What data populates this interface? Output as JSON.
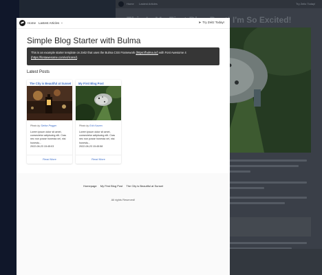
{
  "background_window": {
    "nav": {
      "home_label": "Home",
      "articles_label": "Lastest Articles",
      "cta_label": "Try Zeitz Today!"
    },
    "title": "This Is My First Blog Post! I'm So Excited!"
  },
  "nav": {
    "home_label": "Home",
    "articles_label": "Lastest Articles",
    "chevron": "⌄",
    "cta_icon": "➤",
    "cta_label": "Try Zeitz Today!"
  },
  "page": {
    "title": "Simple Blog Starter with Bulma",
    "notice_intro": "This is an example starter template on Zeitz that uses the Bulma CSS Framework ",
    "notice_link1": "(https://bulma.io/)",
    "notice_mid": " with Font Awesome 4 ",
    "notice_link2": "(https://fontawesome.com/v4/icons/)",
    "notice_end": ".",
    "section_title": "Latest Posts"
  },
  "posts": [
    {
      "title": "The City is Beautiful at Sunset",
      "credit_prefix": "Photo by ",
      "credit_name": "Stefan Pegger",
      "excerpt": "Lorem ipsum dolor sit amet, consectetur adipiscing elit. Cras nec non posse honesta vel, nisi honestu...",
      "date": "2022-08-23 15:45:03",
      "read_more": "Read More"
    },
    {
      "title": "My First Blog Post",
      "credit_prefix": "Photo by ",
      "credit_name": "Erik Karzen",
      "excerpt": "Lorem ipsum dolor sit amet, consectetur adipiscing elit. Cras nec non posse honesta vel, nisi honestu...",
      "date": "2022-08-23 15:45:58",
      "read_more": "Read More"
    }
  ],
  "footer": {
    "links": [
      "Homepage",
      "My First Blog Post",
      "The City is Beautiful at Sunset"
    ],
    "copyright": "All rights Reserved!"
  },
  "colors": {
    "link": "#3e6ec9",
    "notice_bg": "#363636",
    "background": "#1f2733"
  },
  "icons": {
    "logo": "zeitz-logo-icon",
    "cta": "paper-plane-icon",
    "chevron": "chevron-down-icon"
  }
}
